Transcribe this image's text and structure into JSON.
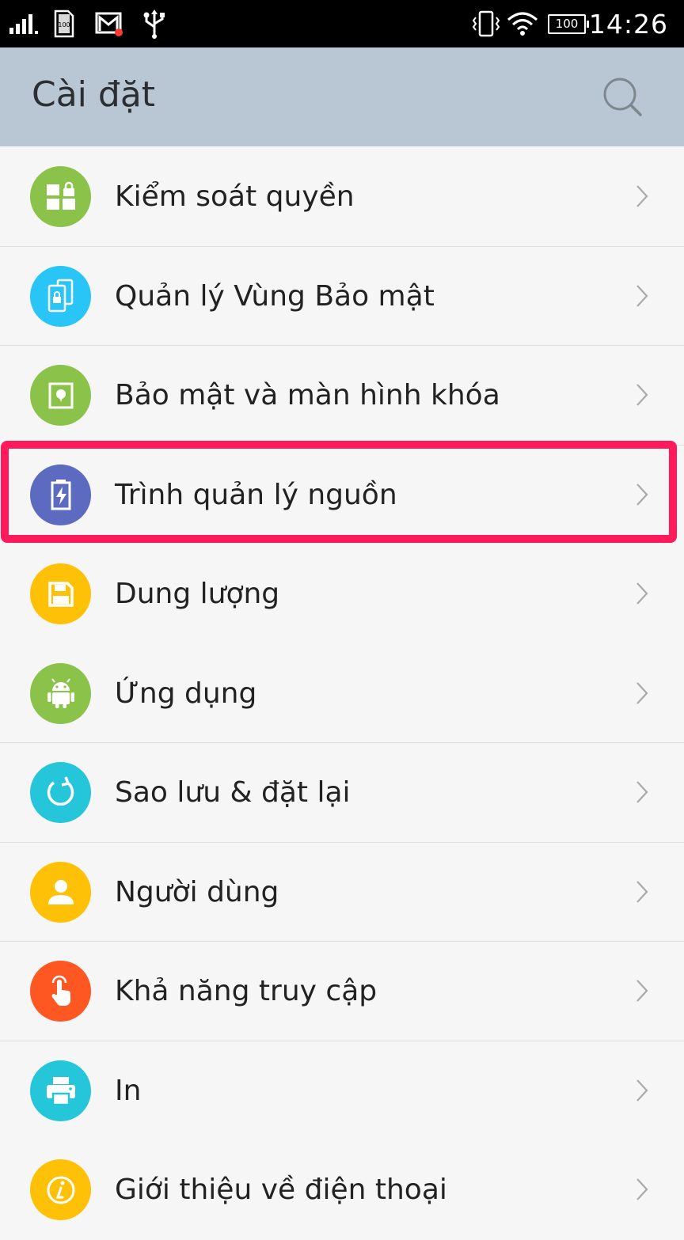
{
  "status_bar": {
    "time": "14:26",
    "battery_level": "100",
    "sim_badge": "100",
    "icons": [
      "signal-icon",
      "sim-card-icon",
      "gmail-icon",
      "usb-icon",
      "vibrate-icon",
      "wifi-icon",
      "battery-icon"
    ]
  },
  "header": {
    "title": "Cài đặt",
    "search_icon": "search-icon"
  },
  "colors": {
    "header_bg": "#b8c7d3",
    "highlight": "#ff1a5c",
    "green": "#8bc34a",
    "cyan": "#26c6da",
    "indigo": "#5c6bc0",
    "yellow": "#ffc107",
    "orange": "#ff5722"
  },
  "settings": {
    "items": [
      {
        "label": "Kiểm soát quyền",
        "icon": "permissions-icon",
        "color": "#8bc34a"
      },
      {
        "label": "Quản lý Vùng Bảo mật",
        "icon": "secure-zone-icon",
        "color": "#29c5f6"
      },
      {
        "label": "Bảo mật và màn hình khóa",
        "icon": "lock-screen-icon",
        "color": "#8bc34a"
      },
      {
        "label": "Trình quản lý nguồn",
        "icon": "battery-manager-icon",
        "color": "#5c6bc0",
        "highlighted": true
      },
      {
        "label": "Dung lượng",
        "icon": "storage-icon",
        "color": "#ffc107"
      },
      {
        "label": "Ứng dụng",
        "icon": "android-icon",
        "color": "#8bc34a"
      },
      {
        "label": "Sao lưu & đặt lại",
        "icon": "backup-reset-icon",
        "color": "#26c6da"
      },
      {
        "label": "Người dùng",
        "icon": "user-icon",
        "color": "#ffc107"
      },
      {
        "label": "Khả năng truy cập",
        "icon": "accessibility-icon",
        "color": "#ff5722"
      },
      {
        "label": "In",
        "icon": "printer-icon",
        "color": "#26c6da"
      },
      {
        "label": "Giới thiệu về điện thoại",
        "icon": "info-icon",
        "color": "#ffc107"
      }
    ]
  }
}
